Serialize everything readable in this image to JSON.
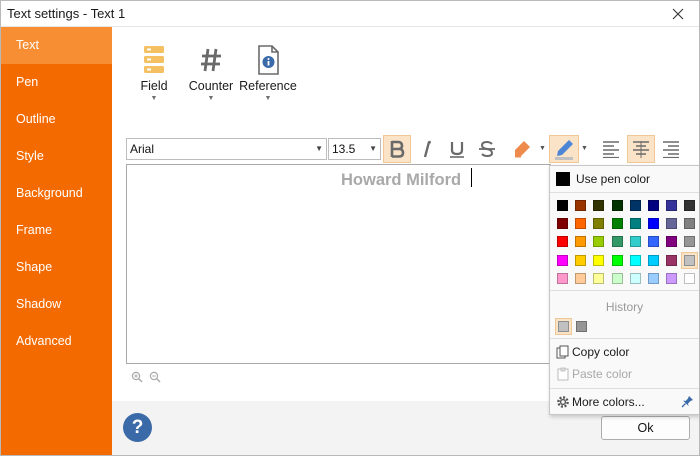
{
  "window": {
    "title": "Text settings - Text 1"
  },
  "sidebar": {
    "items": [
      {
        "label": "Text",
        "active": true
      },
      {
        "label": "Pen",
        "active": false
      },
      {
        "label": "Outline",
        "active": false
      },
      {
        "label": "Style",
        "active": false
      },
      {
        "label": "Background",
        "active": false
      },
      {
        "label": "Frame",
        "active": false
      },
      {
        "label": "Shape",
        "active": false
      },
      {
        "label": "Shadow",
        "active": false
      },
      {
        "label": "Advanced",
        "active": false
      }
    ]
  },
  "insert": {
    "field_label": "Field",
    "counter_label": "Counter",
    "reference_label": "Reference"
  },
  "toolbar": {
    "font_family": "Arial",
    "font_size": "13.5",
    "bold_pressed": true,
    "alignment": "center"
  },
  "editor": {
    "text": "Howard Milford"
  },
  "color_popup": {
    "use_pen_color": "Use pen color",
    "history_label": "History",
    "copy_color": "Copy color",
    "paste_color": "Paste color",
    "more_colors": "More colors...",
    "selected_color": "#c0c0c0",
    "palette": [
      [
        "#000000",
        "#993300",
        "#333300",
        "#003300",
        "#003366",
        "#000080",
        "#333399",
        "#333333"
      ],
      [
        "#800000",
        "#ff6600",
        "#808000",
        "#008000",
        "#008080",
        "#0000ff",
        "#666699",
        "#808080"
      ],
      [
        "#ff0000",
        "#ff9900",
        "#99cc00",
        "#339966",
        "#33cccc",
        "#3366ff",
        "#800080",
        "#969696"
      ],
      [
        "#ff00ff",
        "#ffcc00",
        "#ffff00",
        "#00ff00",
        "#00ffff",
        "#00ccff",
        "#993366",
        "#c0c0c0"
      ],
      [
        "#ff99cc",
        "#ffcc99",
        "#ffff99",
        "#ccffcc",
        "#ccffff",
        "#99ccff",
        "#cc99ff",
        "#ffffff"
      ]
    ],
    "history": [
      "#c0c0c0",
      "#969696"
    ]
  },
  "footer": {
    "ok_label": "Ok"
  },
  "colors": {
    "accent": "#f36b00",
    "accent_active": "#f78e33",
    "help": "#3b6aa8",
    "field_icon": "#f4c062"
  }
}
